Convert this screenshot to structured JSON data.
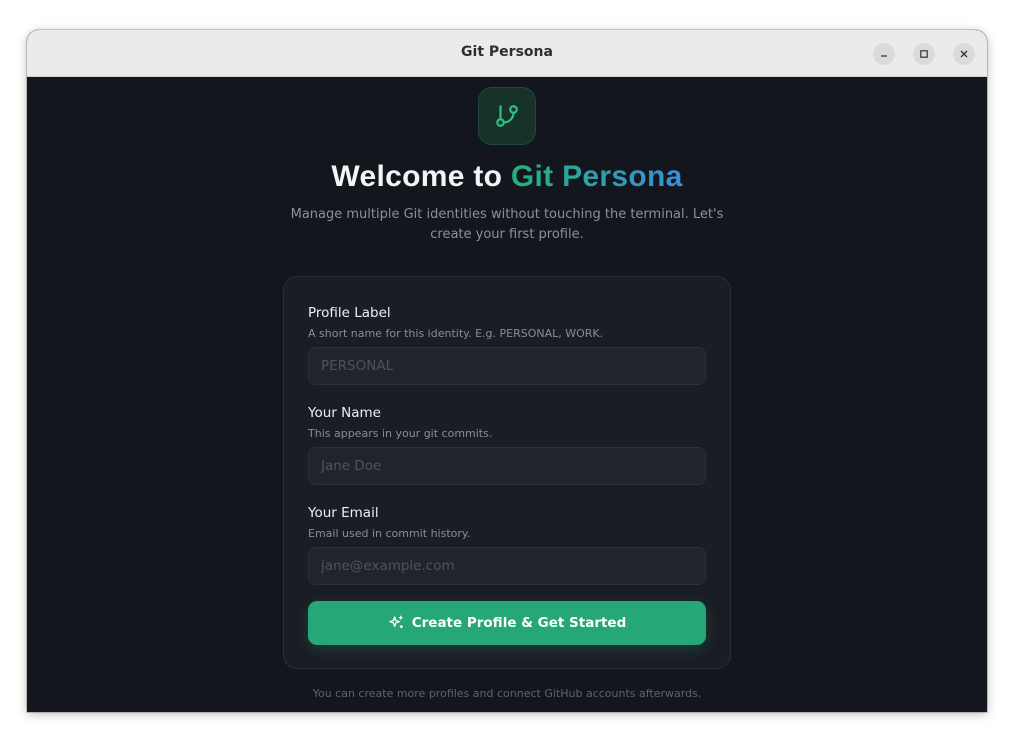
{
  "window": {
    "title": "Git Persona"
  },
  "hero": {
    "heading_prefix": "Welcome to ",
    "heading_accent": "Git Persona",
    "subtitle": "Manage multiple Git identities without touching the terminal. Let's create your first profile.",
    "icon": "git-branch-icon"
  },
  "form": {
    "profile_label": {
      "label": "Profile Label",
      "help": "A short name for this identity. E.g. PERSONAL, WORK.",
      "placeholder": "PERSONAL",
      "value": ""
    },
    "name": {
      "label": "Your Name",
      "help": "This appears in your git commits.",
      "placeholder": "Jane Doe",
      "value": ""
    },
    "email": {
      "label": "Your Email",
      "help": "Email used in commit history.",
      "placeholder": "jane@example.com",
      "value": ""
    },
    "submit": {
      "label": "Create Profile & Get Started",
      "icon": "sparkles-icon"
    }
  },
  "footer_note": "You can create more profiles and connect GitHub accounts afterwards.",
  "colors": {
    "background": "#13161c",
    "card": "#1a1d24",
    "accent_green": "#25a777",
    "accent_blue": "#3a8fd8"
  }
}
